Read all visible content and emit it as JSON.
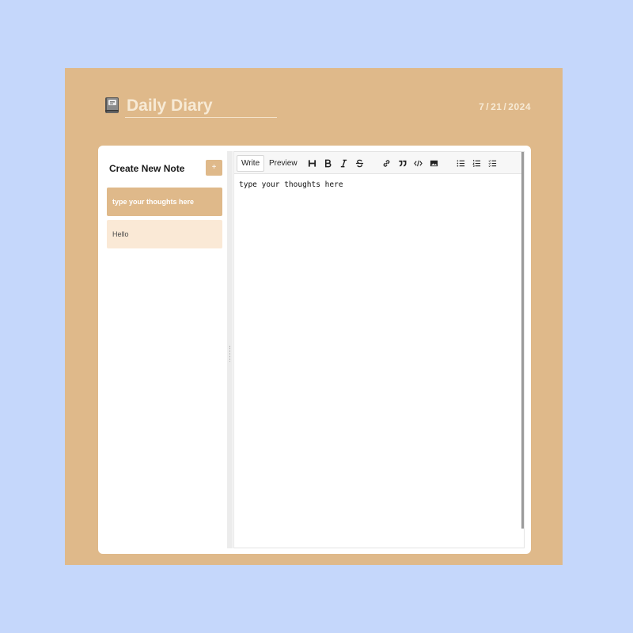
{
  "header": {
    "title": "Daily Diary",
    "date": {
      "month": "7",
      "day": "21",
      "year": "2024"
    }
  },
  "sidebar": {
    "title": "Create New Note",
    "add_label": "+",
    "notes": [
      {
        "label": "type your thoughts here",
        "active": true
      },
      {
        "label": "Hello",
        "active": false
      }
    ]
  },
  "editor": {
    "tabs": {
      "write": "Write",
      "preview": "Preview"
    },
    "content": "type your thoughts here"
  },
  "colors": {
    "page_bg": "#c5d7fb",
    "accent": "#dfb98a",
    "note_idle": "#fae9d6"
  }
}
